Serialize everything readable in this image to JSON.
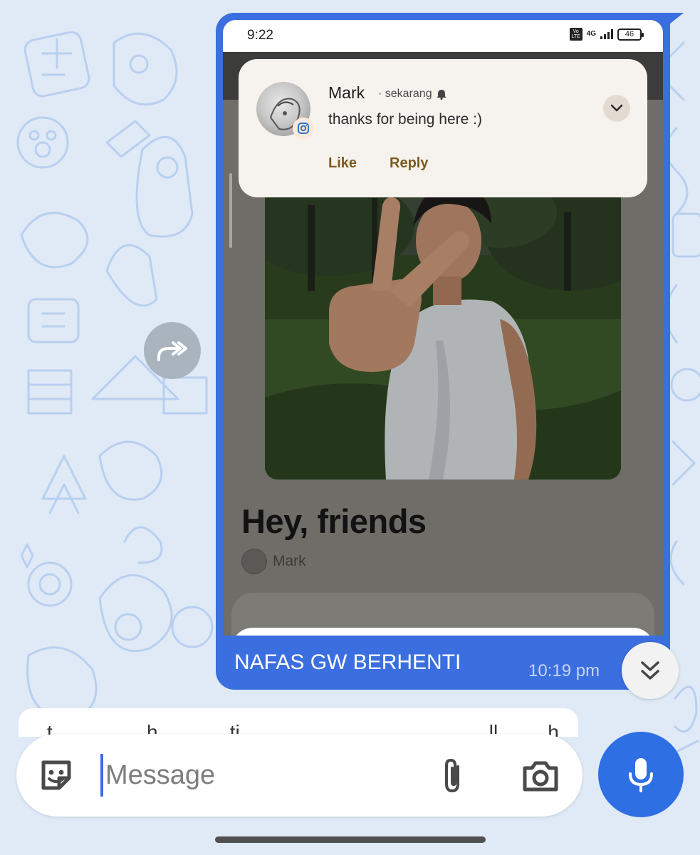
{
  "phone_screenshot": {
    "status_bar": {
      "time": "9:22",
      "volte_label": "Vo LTE",
      "network": "4G",
      "battery": "46"
    },
    "notification": {
      "app_icon": "instagram-icon",
      "sender": "Mark",
      "meta": "· sekarang",
      "message": "thanks for being here :)",
      "actions": {
        "like": "Like",
        "reply": "Reply"
      }
    },
    "post": {
      "title": "Hey, friends",
      "author": "Mark"
    }
  },
  "message": {
    "caption": "NAFAS GW BERHENTI",
    "time": "10:19 pm"
  },
  "next_message_partial": "t ... ... ... ... h ... ... ... ti ... ... ... ... ... ... ... ... ... ... ... ll ... ... h ... ... ... ... ... t",
  "composer": {
    "placeholder": "Message",
    "icons": [
      "sticker-icon",
      "paperclip-icon",
      "camera-icon",
      "microphone-icon"
    ]
  },
  "colors": {
    "bubble": "#3b6fe0",
    "mic_button": "#2f6fe4",
    "chat_background": "#dfeaf6",
    "doodles": "#b9cff0"
  }
}
